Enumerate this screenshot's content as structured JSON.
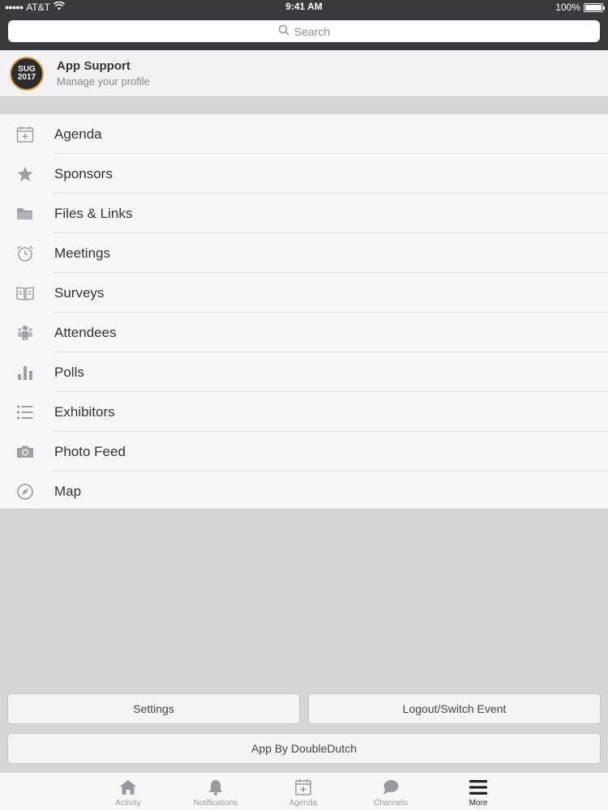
{
  "status_bar": {
    "carrier": "AT&T",
    "time": "9:41 AM",
    "battery": "100%"
  },
  "search": {
    "placeholder": "Search"
  },
  "profile": {
    "name": "App Support",
    "subtitle": "Manage your profile",
    "logo_text_line1": "SUG",
    "logo_text_line2": "2017"
  },
  "menu": {
    "items": [
      {
        "label": "Agenda",
        "icon": "calendar-icon"
      },
      {
        "label": "Sponsors",
        "icon": "star-icon"
      },
      {
        "label": "Files & Links",
        "icon": "folder-icon"
      },
      {
        "label": "Meetings",
        "icon": "alarm-clock-icon"
      },
      {
        "label": "Surveys",
        "icon": "open-book-icon"
      },
      {
        "label": "Attendees",
        "icon": "people-icon"
      },
      {
        "label": "Polls",
        "icon": "bar-chart-icon"
      },
      {
        "label": "Exhibitors",
        "icon": "list-icon"
      },
      {
        "label": "Photo Feed",
        "icon": "camera-icon"
      },
      {
        "label": "Map",
        "icon": "compass-icon"
      }
    ]
  },
  "buttons": {
    "settings": "Settings",
    "logout": "Logout/Switch Event",
    "app_by": "App By DoubleDutch"
  },
  "tabbar": {
    "tabs": [
      {
        "label": "Activity",
        "icon": "home-icon",
        "active": false
      },
      {
        "label": "Notifications",
        "icon": "bell-icon",
        "active": false
      },
      {
        "label": "Agenda",
        "icon": "calendar-icon",
        "active": false
      },
      {
        "label": "Channels",
        "icon": "chat-bubble-icon",
        "active": false
      },
      {
        "label": "More",
        "icon": "hamburger-menu-icon",
        "active": true
      }
    ]
  },
  "colors": {
    "header_bg": "#3a3a3c",
    "page_bg": "#d6d6d8",
    "list_bg": "#f7f7f8",
    "icon_gray": "#a0a0a4",
    "active_tab": "#222222"
  }
}
